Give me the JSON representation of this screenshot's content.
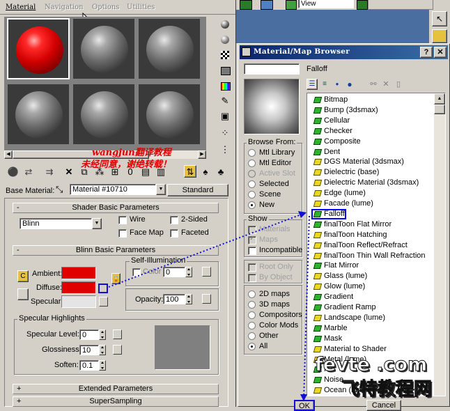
{
  "menu": {
    "items": [
      "Material",
      "Navigation",
      "Options",
      "Utilities"
    ]
  },
  "watermark": {
    "line1": "wangjun翻译教程",
    "line2": "未经同意，谢绝转载！",
    "brand": "fevte .com",
    "brand_cn": "飞特教程网"
  },
  "base_material": {
    "label": "Base Material:",
    "value": "Material #10710",
    "type_button": "Standard"
  },
  "shader_rollup": {
    "title": "Shader Basic Parameters",
    "sign": "-",
    "shader": "Blinn",
    "wire": "Wire",
    "two_sided": "2-Sided",
    "face_map": "Face Map",
    "faceted": "Faceted"
  },
  "blinn_rollup": {
    "title": "Blinn Basic Parameters",
    "sign": "-",
    "self_illum": "Self-Illumination",
    "color_label": "Color",
    "color_value": "0",
    "ambient": "Ambient:",
    "diffuse": "Diffuse:",
    "specular": "Specular:",
    "opacity_label": "Opacity:",
    "opacity_value": "100",
    "ambient_color": "#e00000",
    "diffuse_color": "#e00000",
    "specular_color": "#e4e4e4",
    "lock_letter": "C"
  },
  "spec_highlights": {
    "title": "Specular Highlights",
    "level_label": "Specular Level:",
    "level_value": "0",
    "gloss_label": "Glossiness:",
    "gloss_value": "10",
    "soften_label": "Soften:",
    "soften_value": "0.1"
  },
  "extended_rollup": {
    "title": "Extended Parameters",
    "sign": "+"
  },
  "supersampling_rollup": {
    "title": "SuperSampling",
    "sign": "+"
  },
  "bg_toolbar": {
    "view_label": "View"
  },
  "browser": {
    "title": "Material/Map Browser",
    "help_button": "?",
    "close_button": "✕",
    "name_field": "",
    "current_name": "Falloff",
    "browse_from_title": "Browse From:",
    "browse_from": [
      {
        "label": "Mtl Library",
        "enabled": true,
        "selected": false
      },
      {
        "label": "Mtl Editor",
        "enabled": true,
        "selected": false
      },
      {
        "label": "Active Slot",
        "enabled": false,
        "selected": false
      },
      {
        "label": "Selected",
        "enabled": true,
        "selected": false
      },
      {
        "label": "Scene",
        "enabled": true,
        "selected": false
      },
      {
        "label": "New",
        "enabled": true,
        "selected": true
      }
    ],
    "show_title": "Show",
    "show": [
      {
        "label": "Materials",
        "enabled": false,
        "checked": false
      },
      {
        "label": "Maps",
        "enabled": false,
        "checked": true
      },
      {
        "label": "Incompatible",
        "enabled": true,
        "checked": false
      }
    ],
    "root_only": "Root Only",
    "by_object": "By Object",
    "map_types": [
      {
        "label": "2D maps",
        "selected": false
      },
      {
        "label": "3D maps",
        "selected": false
      },
      {
        "label": "Compositors",
        "selected": false
      },
      {
        "label": "Color Mods",
        "selected": false
      },
      {
        "label": "Other",
        "selected": false
      },
      {
        "label": "All",
        "selected": true
      }
    ],
    "list": [
      "Bitmap",
      "Bump (3dsmax)",
      "Cellular",
      "Checker",
      "Composite",
      "Dent",
      "DGS Material (3dsmax)",
      "Dielectric (base)",
      "Dielectric Material (3dsmax)",
      "Edge (lume)",
      "Facade (lume)",
      "Falloff",
      "finalToon Flat Mirror",
      "finalToon Hatching",
      "finalToon Reflect/Refract",
      "finalToon Thin Wall Refraction",
      "Flat Mirror",
      "Glass (lume)",
      "Glow (lume)",
      "Gradient",
      "Gradient Ramp",
      "Landscape (lume)",
      "Marble",
      "Mask",
      "Material to Shader",
      "Metal (lume)",
      "Mix",
      "Noise",
      "Ocean (lume)"
    ],
    "list_icon_colors": [
      "green",
      "green",
      "green",
      "green",
      "green",
      "green",
      "yellow",
      "yellow",
      "yellow",
      "yellow",
      "yellow",
      "green",
      "green",
      "yellow",
      "yellow",
      "yellow",
      "green",
      "yellow",
      "yellow",
      "green",
      "green",
      "yellow",
      "green",
      "green",
      "yellow",
      "yellow",
      "green",
      "green",
      "yellow"
    ],
    "selected_item": "Falloff",
    "ok_button": "OK",
    "cancel_button": "Cancel"
  },
  "colors": {
    "titlebar": "#0a246a",
    "selection_border": "#0000ff",
    "watermark_red": "#e00000",
    "arrow_blue": "#1010d0"
  }
}
